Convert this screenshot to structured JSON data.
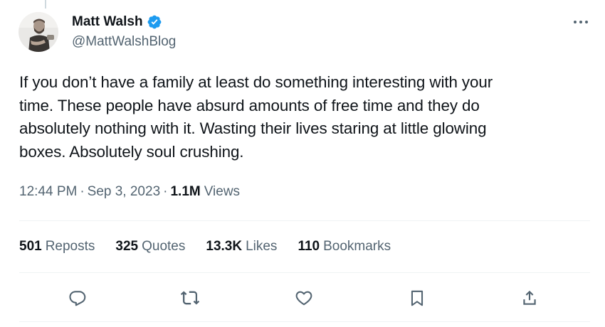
{
  "author": {
    "display_name": "Matt Walsh",
    "handle": "@MattWalshBlog",
    "verified": true,
    "verified_color": "#1d9bf0"
  },
  "tweet": {
    "text_lines": [
      "If you don’t have a family at least do something interesting with your",
      "time. These people have absurd amounts of free time and they do",
      "absolutely nothing with it. Wasting their lives staring at little glowing",
      "boxes. Absolutely soul crushing."
    ]
  },
  "meta": {
    "time": "12:44 PM",
    "separator": "·",
    "date": "Sep 3, 2023",
    "views_count": "1.1M",
    "views_label": "Views"
  },
  "stats": {
    "reposts": {
      "count": "501",
      "label": "Reposts"
    },
    "quotes": {
      "count": "325",
      "label": "Quotes"
    },
    "likes": {
      "count": "13.3K",
      "label": "Likes"
    },
    "bookmarks": {
      "count": "110",
      "label": "Bookmarks"
    }
  },
  "icons": {
    "more": "more-horizontal-icon",
    "reply": "reply-icon",
    "repost": "repost-icon",
    "like": "heart-icon",
    "bookmark": "bookmark-icon",
    "share": "share-icon"
  },
  "colors": {
    "text_primary": "#0f1419",
    "text_secondary": "#536471",
    "icon": "#536471",
    "divider": "#eff3f4"
  }
}
